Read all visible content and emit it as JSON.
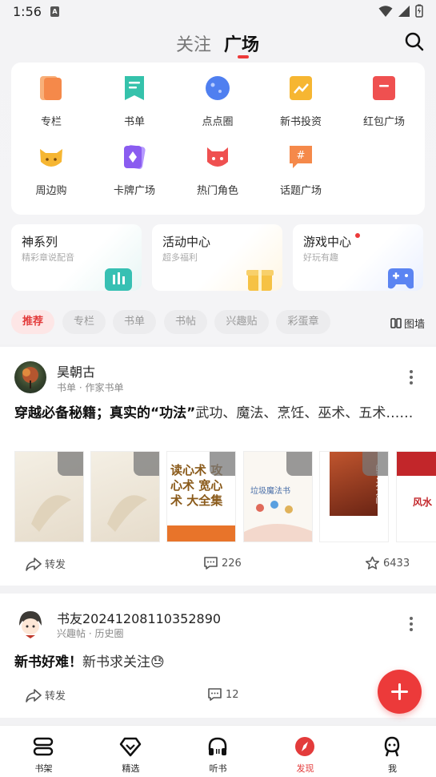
{
  "status_bar": {
    "time": "1:56",
    "notification_badge": "A"
  },
  "header": {
    "tabs": [
      {
        "label": "关注"
      },
      {
        "label": "广场"
      }
    ],
    "active_tab": "广场"
  },
  "categories": [
    {
      "label": "专栏",
      "icon": "column-icon",
      "color": "#f5894a"
    },
    {
      "label": "书单",
      "icon": "booklist-icon",
      "color": "#35c2ab"
    },
    {
      "label": "点点圈",
      "icon": "planet-icon",
      "color": "#4f7ff0"
    },
    {
      "label": "新书投资",
      "icon": "invest-icon",
      "color": "#f6b632"
    },
    {
      "label": "红包广场",
      "icon": "redpacket-icon",
      "color": "#ef5050"
    },
    {
      "label": "周边购",
      "icon": "cat-icon",
      "color": "#f6b632"
    },
    {
      "label": "卡牌广场",
      "icon": "card-icon",
      "color": "#8a5cf0"
    },
    {
      "label": "热门角色",
      "icon": "hot-character-icon",
      "color": "#ef5050"
    },
    {
      "label": "话题广场",
      "icon": "topic-icon",
      "color": "#f5894a"
    }
  ],
  "features": [
    {
      "title": "神系列",
      "subtitle": "精彩章说配音"
    },
    {
      "title": "活动中心",
      "subtitle": "超多福利"
    },
    {
      "title": "游戏中心",
      "subtitle": "好玩有趣"
    }
  ],
  "filters": {
    "chips": [
      "推荐",
      "专栏",
      "书单",
      "书帖",
      "兴趣贴",
      "彩蛋章"
    ],
    "active": "推荐",
    "gallery_label": "图墙"
  },
  "posts": [
    {
      "author": "昊朝古",
      "meta": "书单 · 作家书单",
      "title_bold": "穿越必备秘籍；真实的“功法”",
      "text": "武功、魔法、烹饪、巫术、五术……",
      "book_covers": [
        "",
        "",
        "读心术 攻心术 宽心术 大全集",
        "垃圾魔法书",
        "的艺术之门",
        "风水"
      ],
      "actions": {
        "share": "转发",
        "comments": "226",
        "stars": "6433"
      }
    },
    {
      "author": "书友20241208110352890",
      "meta": "兴趣帖 · 历史圈",
      "title_bold": "新书好难！",
      "text": "新书求关注😓",
      "actions": {
        "share": "转发",
        "comments": "12"
      }
    }
  ],
  "bottom_nav": [
    {
      "label": "书架",
      "icon": "bookshelf-icon"
    },
    {
      "label": "精选",
      "icon": "diamond-icon"
    },
    {
      "label": "听书",
      "icon": "headphones-icon"
    },
    {
      "label": "发现",
      "icon": "compass-icon"
    },
    {
      "label": "我",
      "icon": "profile-icon"
    }
  ],
  "bottom_nav_active": "发现",
  "colors": {
    "accent": "#ec3a3a",
    "background": "#f2f2f4"
  }
}
